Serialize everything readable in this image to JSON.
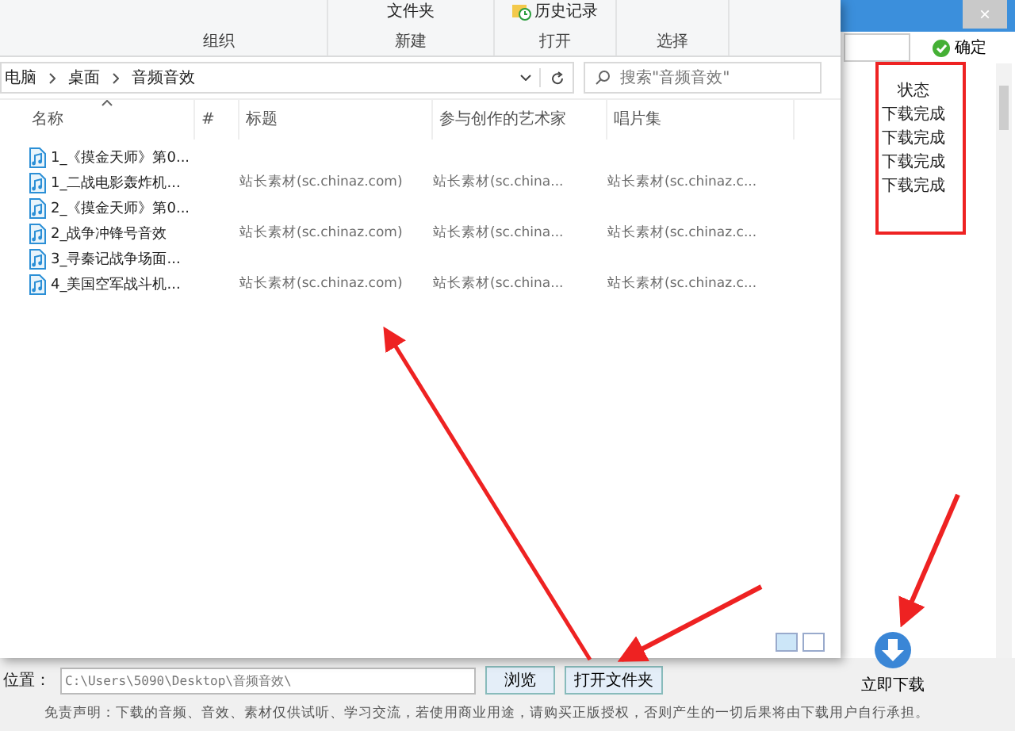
{
  "explorer": {
    "ribbon": {
      "groups": [
        {
          "label": "组织"
        },
        {
          "label": "新建",
          "items": [
            "文件夹"
          ]
        },
        {
          "label": "打开",
          "items": [
            "历史记录"
          ]
        },
        {
          "label": "选择"
        }
      ]
    },
    "address": {
      "path": [
        "电脑",
        "桌面",
        "音频音效"
      ],
      "search_placeholder": "搜索\"音频音效\""
    },
    "columns": [
      "名称",
      "#",
      "标题",
      "参与创作的艺术家",
      "唱片集"
    ],
    "rows": [
      {
        "name": "1_《摸金天师》第0..."
      },
      {
        "name": "1_二战电影轰炸机...",
        "title": "站长素材(sc.chinaz.com)",
        "artist": "站长素材(sc.china...",
        "album": "站长素材(sc.chinaz.c..."
      },
      {
        "name": "2_《摸金天师》第0..."
      },
      {
        "name": "2_战争冲锋号音效",
        "title": "站长素材(sc.chinaz.com)",
        "artist": "站长素材(sc.china...",
        "album": "站长素材(sc.chinaz.c..."
      },
      {
        "name": "3_寻秦记战争场面..."
      },
      {
        "name": "4_美国空军战斗机...",
        "title": "站长素材(sc.chinaz.com)",
        "artist": "站长素材(sc.china...",
        "album": "站长素材(sc.chinaz.c..."
      }
    ]
  },
  "app": {
    "close_button": "×",
    "confirm_button": "确定",
    "status_header": "状态",
    "statuses": [
      "下载完成",
      "下载完成",
      "下载完成",
      "下载完成"
    ],
    "location_label": "位置：",
    "location_value": "C:\\Users\\5090\\Desktop\\音频音效\\",
    "browse_button": "浏览",
    "open_folder_button": "打开文件夹",
    "download_button": "立即下载",
    "disclaimer": "免责声明：下载的音频、音效、素材仅供试听、学习交流，若使用商业用途，请购买正版授权，否则产生的一切后果将由下载用户自行承担。"
  }
}
